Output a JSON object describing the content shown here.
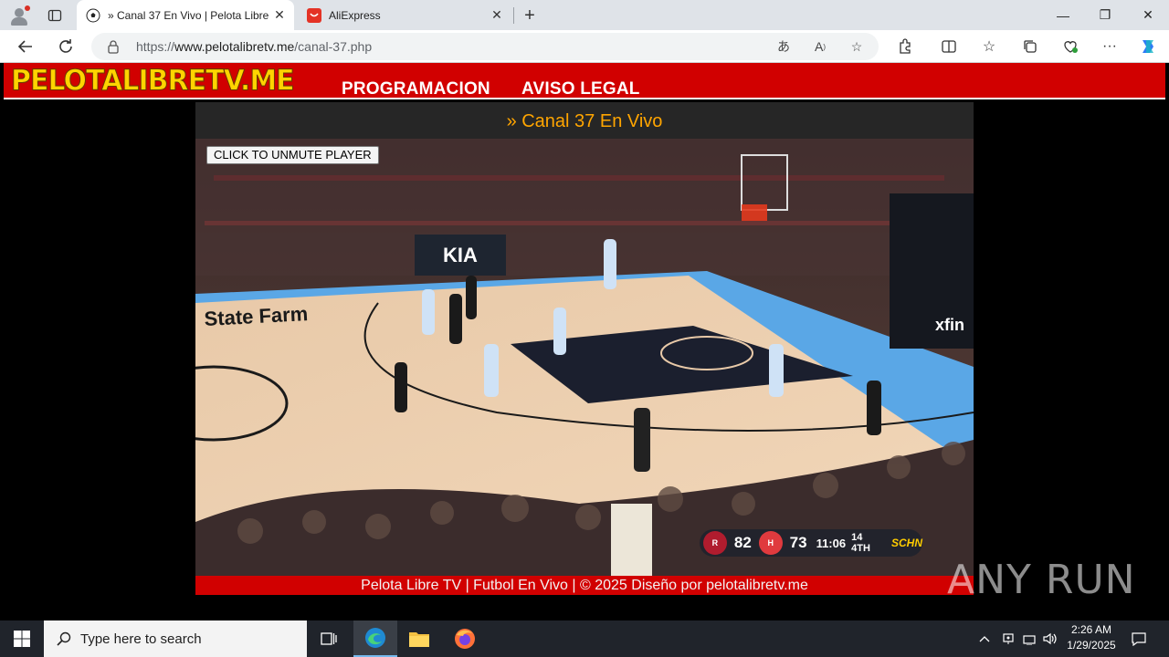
{
  "browser": {
    "tabs": [
      {
        "title": "» Canal 37 En Vivo | Pelota Libre T",
        "active": true
      },
      {
        "title": "AliExpress",
        "active": false
      }
    ],
    "url_prefix": "https://",
    "url_domain": "www.pelotalibretv.me",
    "url_path": "/canal-37.php",
    "window_controls": {
      "minimize": "—",
      "restore": "❐",
      "close": "✕"
    }
  },
  "site": {
    "logo": "PELOTALIBRETV.ME",
    "nav": [
      "PROGRAMACION",
      "AVISO LEGAL"
    ],
    "channel_title": "» Canal 37 En Vivo",
    "unmute_label": "CLICK TO UNMUTE PLAYER",
    "footer": "Pelota Libre TV | Futbol En Vivo | © 2025 Diseño por pelotalibretv.me"
  },
  "scoreboard": {
    "home_score": "82",
    "away_score": "73",
    "clock": "11:06",
    "period": "14 4TH",
    "network": "SCHN"
  },
  "watermark": "ANY RUN",
  "taskbar": {
    "search_placeholder": "Type here to search",
    "time": "2:26 AM",
    "date": "1/29/2025"
  },
  "colors": {
    "header_red": "#d10000",
    "channel_orange": "#ffa500",
    "logo_yellow": "#ffd400"
  }
}
